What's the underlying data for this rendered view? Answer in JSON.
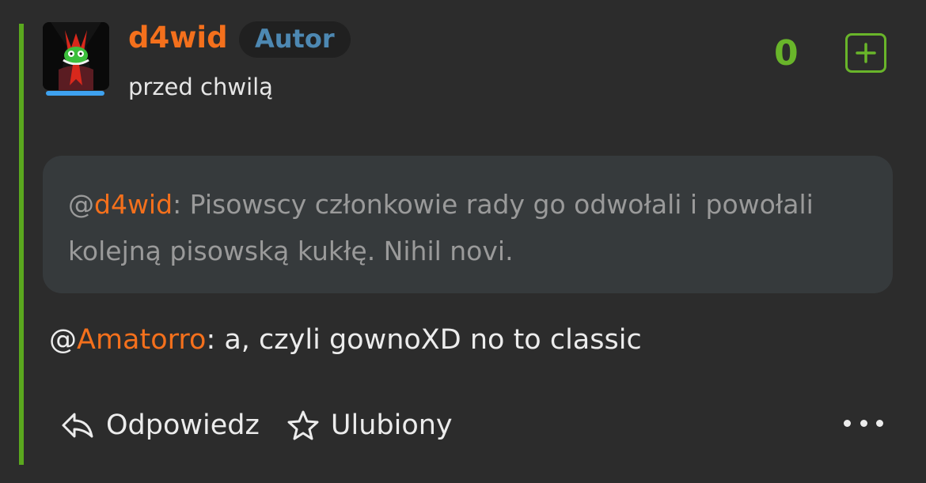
{
  "comment": {
    "author": "d4wid",
    "badge": "Autor",
    "timestamp": "przed chwilą",
    "vote_count": "0",
    "quote": {
      "prefix": "@",
      "mention": "d4wid",
      "text": ": Pisowscy członkowie rady go odwołali i powołali kolejną pisowską kukłę. Nihil novi."
    },
    "body": {
      "prefix": "@",
      "mention": "Amatorro",
      "text": ": a, czyli gownoXD no to classic"
    },
    "actions": {
      "reply": "Odpowiedz",
      "favorite": "Ulubiony"
    }
  },
  "colors": {
    "accent_orange": "#f4701c",
    "thread_green": "#5aa81e",
    "vote_green": "#69b52a",
    "badge_blue": "#4d88b2",
    "background": "#2c2c2c"
  },
  "icons": [
    "reply-arrow-icon",
    "star-outline-icon",
    "plus-icon",
    "more-dots-icon"
  ]
}
